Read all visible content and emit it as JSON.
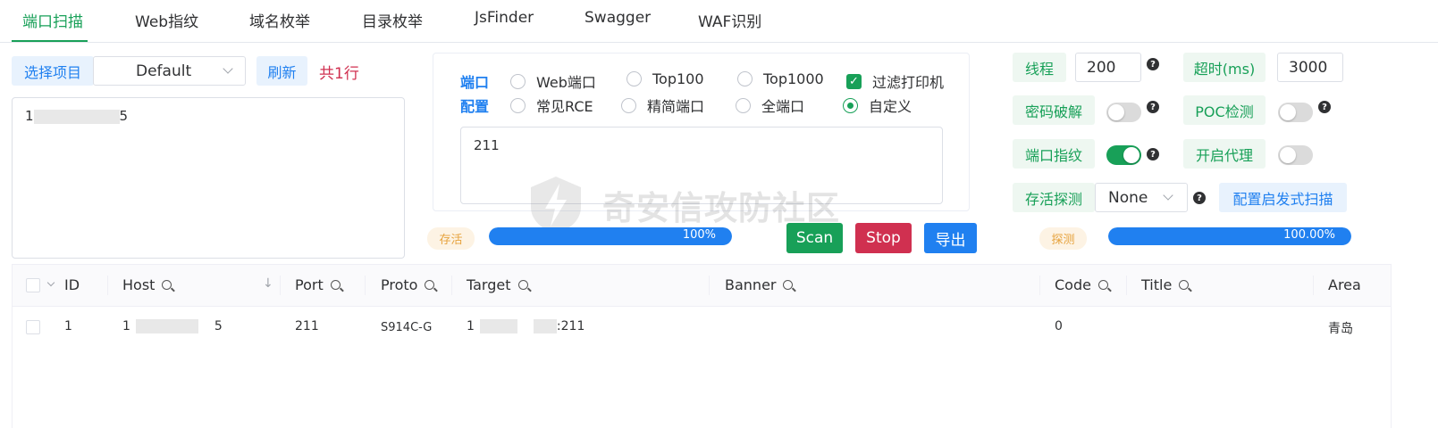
{
  "tabs": [
    {
      "label": "端口扫描",
      "active": true
    },
    {
      "label": "Web指纹"
    },
    {
      "label": "域名枚举"
    },
    {
      "label": "目录枚举"
    },
    {
      "label": "JsFinder"
    },
    {
      "label": "Swagger"
    },
    {
      "label": "WAF识别"
    }
  ],
  "left": {
    "select_project_label": "选择项目",
    "project_value": "Default",
    "refresh_label": "刷新",
    "count_text": "共1行",
    "hosts_prefix": "1",
    "hosts_suffix": "5"
  },
  "port_config": {
    "label_line1": "端口",
    "label_line2": "配置",
    "options": [
      {
        "label": "Web端口",
        "type": "radio",
        "checked": false
      },
      {
        "label": "Top100",
        "type": "radio",
        "checked": false
      },
      {
        "label": "Top1000",
        "type": "radio",
        "checked": false
      },
      {
        "label": "过滤打印机",
        "type": "checkbox",
        "checked": true
      },
      {
        "label": "常见RCE",
        "type": "radio",
        "checked": false
      },
      {
        "label": "精简端口",
        "type": "radio",
        "checked": false
      },
      {
        "label": "全端口",
        "type": "radio",
        "checked": false
      },
      {
        "label": "自定义",
        "type": "radio",
        "checked": true
      }
    ],
    "ports_value": "211"
  },
  "progress": {
    "alive_label": "存活",
    "alive_percent_text": "100%",
    "alive_fraction": 1.0,
    "detect_label": "探测",
    "detect_percent_text": "100.00%",
    "detect_fraction": 1.0
  },
  "actions": {
    "scan": "Scan",
    "stop": "Stop",
    "export": "导出"
  },
  "settings": {
    "threads_label": "线程",
    "threads_value": "200",
    "timeout_label": "超时(ms)",
    "timeout_value": "3000",
    "password_crack_label": "密码破解",
    "password_crack_on": false,
    "poc_label": "POC检测",
    "poc_on": false,
    "port_fingerprint_label": "端口指纹",
    "port_fingerprint_on": true,
    "proxy_label": "开启代理",
    "proxy_on": false,
    "alive_detect_label": "存活探测",
    "alive_detect_value": "None",
    "heuristic_scan_label": "配置启发式扫描",
    "help_glyph": "?"
  },
  "watermark": "奇安信攻防社区",
  "table": {
    "columns": [
      "ID",
      "Host",
      "Port",
      "Proto",
      "Target",
      "Banner",
      "Code",
      "Title",
      "Area"
    ],
    "rows": [
      {
        "id": "1",
        "host_prefix": "1",
        "host_suffix": "5",
        "port": "211",
        "proto": "S914C-G",
        "target_prefix": "1",
        "target_suffix": ":211",
        "banner": "",
        "code": "0",
        "title": "",
        "area": "青岛"
      }
    ]
  },
  "colors": {
    "accent_green": "#18a058",
    "accent_blue": "#2080f0",
    "danger_red": "#d03050",
    "count_red": "#d03050",
    "warning_orange": "#e6a23c"
  }
}
